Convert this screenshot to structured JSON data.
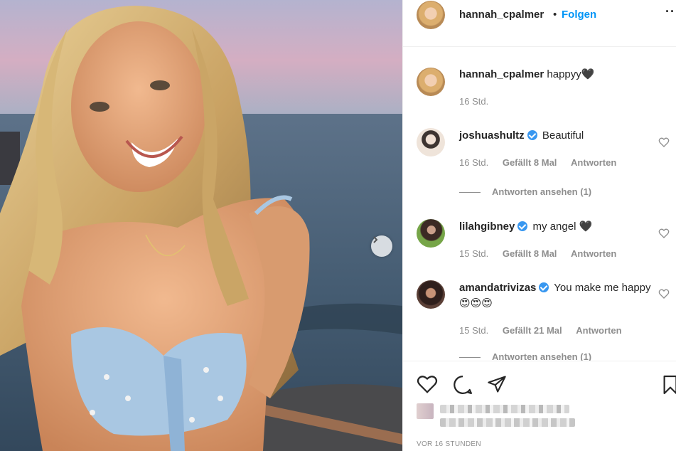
{
  "post": {
    "username": "hannah_cpalmer",
    "separator": "•",
    "follow_label": "Folgen",
    "more_icon": "ellipsis-icon",
    "more_glyph": "··",
    "caption": "happyy",
    "caption_emoji": "🖤",
    "caption_time": "16 Std."
  },
  "comments": [
    {
      "username": "joshuashultz",
      "verified": true,
      "text": "Beautiful",
      "time": "16 Std.",
      "likes": "Gefällt 8 Mal",
      "reply": "Antworten",
      "view_replies": "Antworten ansehen (1)"
    },
    {
      "username": "lilahgibney",
      "verified": true,
      "text": "my angel 🖤",
      "time": "15 Std.",
      "likes": "Gefällt 8 Mal",
      "reply": "Antworten"
    },
    {
      "username": "amandatrivizas",
      "verified": true,
      "text": "You make me happy 😍😍😍",
      "time": "15 Std.",
      "likes": "Gefällt 21 Mal",
      "reply": "Antworten",
      "view_replies": "Antworten ansehen (1)"
    }
  ],
  "footer": {
    "timestamp": "VOR 16 STUNDEN"
  },
  "colors": {
    "accent": "#0095f6",
    "verified": "#3897f0",
    "muted": "#8e8e8e",
    "text": "#262626"
  },
  "icons": [
    "heart-icon",
    "comment-icon",
    "share-icon",
    "bookmark-icon",
    "chevron-right-icon",
    "verified-badge-icon"
  ]
}
